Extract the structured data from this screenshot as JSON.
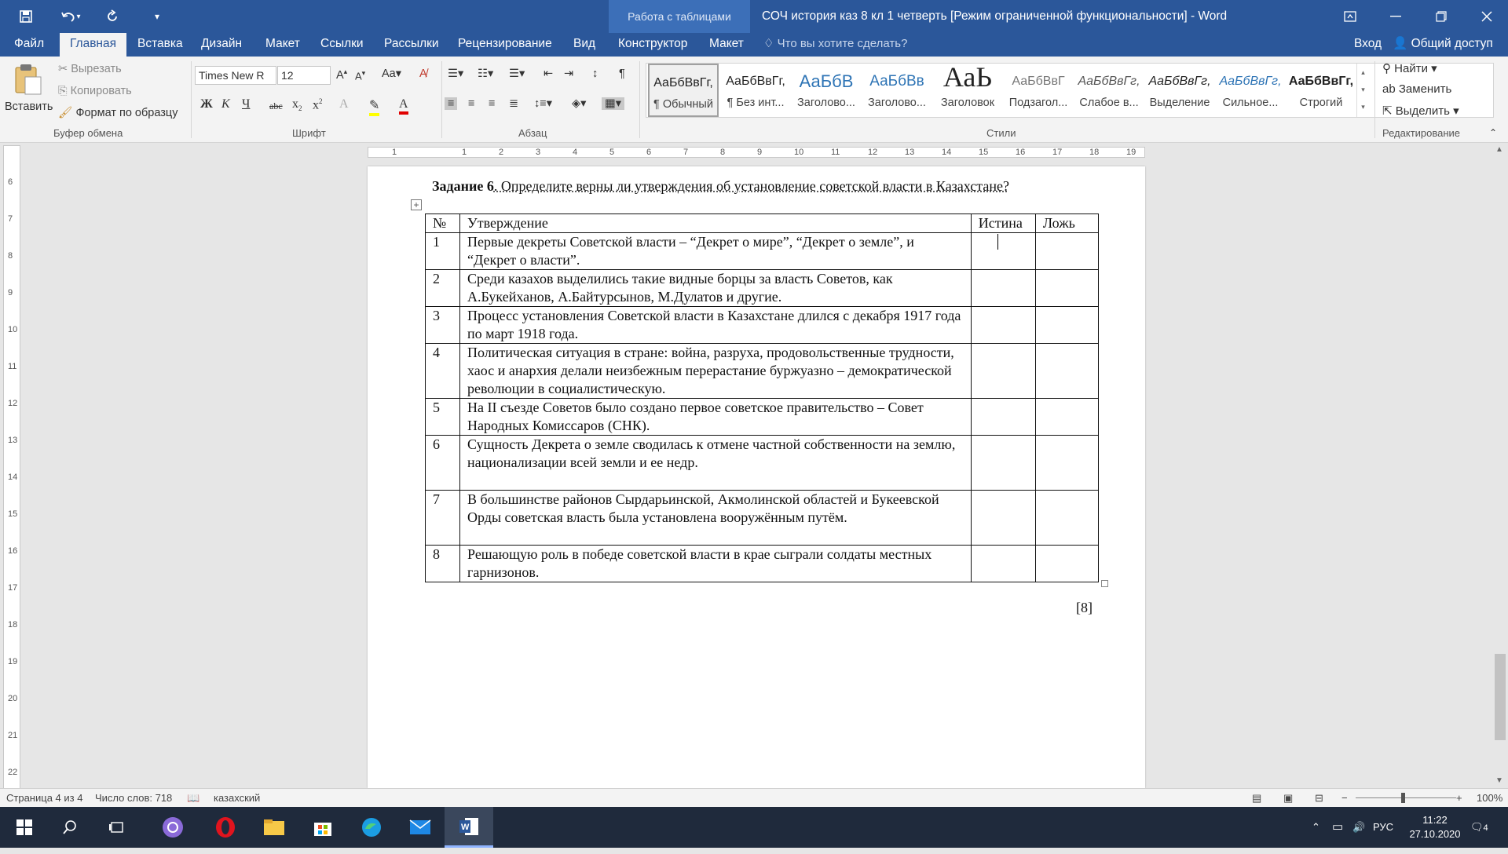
{
  "titlebar": {
    "context_label": "Работа с таблицами",
    "title": "СОЧ история каз 8 кл 1 четверть [Режим ограниченной функциональности] - Word"
  },
  "tabs": [
    {
      "label": "Файл"
    },
    {
      "label": "Главная"
    },
    {
      "label": "Вставка"
    },
    {
      "label": "Дизайн"
    },
    {
      "label": "Макет"
    },
    {
      "label": "Ссылки"
    },
    {
      "label": "Рассылки"
    },
    {
      "label": "Рецензирование"
    },
    {
      "label": "Вид"
    },
    {
      "label": "Конструктор"
    },
    {
      "label": "Макет"
    }
  ],
  "tell_me": "Что вы хотите сделать?",
  "signin": "Вход",
  "share": "Общий доступ",
  "clipboard": {
    "paste": "Вставить",
    "cut": "Вырезать",
    "copy": "Копировать",
    "format_painter": "Формат по образцу",
    "group": "Буфер обмена"
  },
  "font": {
    "name": "Times New R",
    "size": "12",
    "group": "Шрифт"
  },
  "paragraph": {
    "group": "Абзац"
  },
  "styles": {
    "group": "Стили",
    "items": [
      {
        "preview": "АаБбВвГг,",
        "name": "¶ Обычный"
      },
      {
        "preview": "АаБбВвГг,",
        "name": "¶ Без инт..."
      },
      {
        "preview": "АаБбВ",
        "name": "Заголово..."
      },
      {
        "preview": "АаБбВв",
        "name": "Заголово..."
      },
      {
        "preview": "АаЬ",
        "name": "Заголовок"
      },
      {
        "preview": "АаБбВвГ",
        "name": "Подзагол..."
      },
      {
        "preview": "АаБбВвГг,",
        "name": "Слабое в..."
      },
      {
        "preview": "АаБбВвГг,",
        "name": "Выделение"
      },
      {
        "preview": "АаБбВвГг,",
        "name": "Сильное..."
      },
      {
        "preview": "АаБбВвГг,",
        "name": "Строгий"
      }
    ]
  },
  "editing": {
    "find": "Найти",
    "replace": "Заменить",
    "select": "Выделить",
    "group": "Редактирование"
  },
  "ruler": {
    "h": [
      "1",
      "1",
      "2",
      "3",
      "4",
      "5",
      "6",
      "7",
      "8",
      "9",
      "10",
      "11",
      "12",
      "13",
      "14",
      "15",
      "16",
      "17",
      "18",
      "19"
    ],
    "v": [
      "6",
      "7",
      "8",
      "9",
      "10",
      "11",
      "12",
      "13",
      "14",
      "15",
      "16",
      "17",
      "18",
      "19",
      "20",
      "21",
      "22"
    ]
  },
  "document": {
    "task_bold": "Задание 6",
    "task_rest": ". Определите верны ли утверждения  об установление советской власти в Казахстане?",
    "table": {
      "headers": [
        "№",
        "Утверждение",
        "Истина",
        "Ложь"
      ],
      "rows": [
        {
          "n": "1",
          "text": "Первые декреты Советской власти – “Декрет о мире”, “Декрет о земле”, и “Декрет о власти”."
        },
        {
          "n": "2",
          "text": "Среди казахов выделились такие видные борцы за власть Советов, как А.Букейханов, А.Байтурсынов, М.Дулатов и другие."
        },
        {
          "n": "3",
          "text": "Процесс установления Советской власти в Казахстане длился с декабря 1917 года по март 1918 года."
        },
        {
          "n": "4",
          "text": "Политическая ситуация в стране: война, разруха, продовольственные трудности, хаос и анархия делали неизбежным перерастание буржуазно – демократической революции в социалистическую."
        },
        {
          "n": "5",
          "text": "На II съезде Советов было создано первое советское правительство – Совет Народных Комиссаров (СНК)."
        },
        {
          "n": "6",
          "text": "Сущность Декрета о земле сводилась к отмене частной собственности на землю, национализации всей земли и ее недр."
        },
        {
          "n": "7",
          "text": "В большинстве районов Сырдарьинской, Акмолинской областей и Букеевской Орды советская власть была установлена вооружённым путём."
        },
        {
          "n": "8",
          "text": "Решающую роль в победе советской власти в крае сыграли солдаты местных гарнизонов."
        }
      ]
    },
    "score": "[8]"
  },
  "status": {
    "page": "Страница 4 из 4",
    "words": "Число слов: 718",
    "language": "казахский",
    "zoom": "100%"
  },
  "taskbar": {
    "lang": "РУС",
    "time": "11:22",
    "date": "27.10.2020",
    "notifications": "4"
  },
  "colors": {
    "word_blue": "#2b579a",
    "taskbar": "#1f2a3c",
    "ribbon": "#f3f3f3"
  }
}
